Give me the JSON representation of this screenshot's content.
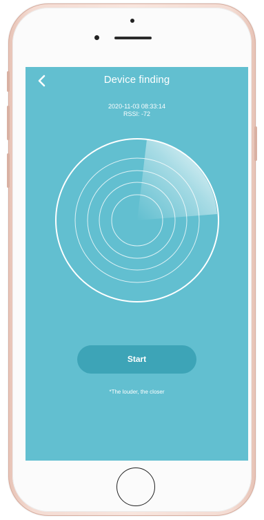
{
  "device": {
    "screen_bg": "#62bfd0",
    "accent": "#3da4b7"
  },
  "header": {
    "back_icon": "chevron-left-icon",
    "title": "Device finding"
  },
  "status": {
    "timestamp": "2020-11-03 08:33:14",
    "rssi": "RSSI:  -72"
  },
  "radar": {
    "icon": "radar-scan-icon",
    "ring_count": 4
  },
  "actions": {
    "start_label": "Start",
    "hint": "*The louder, the closer"
  }
}
